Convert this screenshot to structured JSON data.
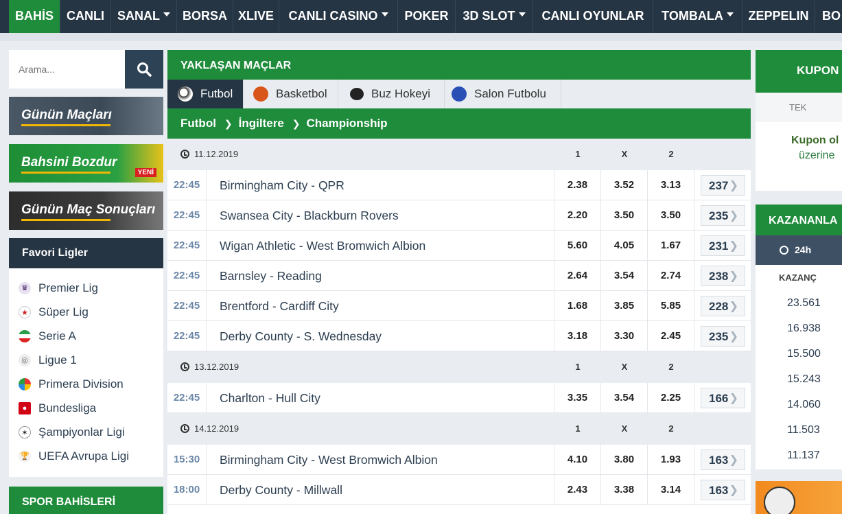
{
  "nav": {
    "items": [
      {
        "label": "BAHİS",
        "active": true,
        "dropdown": false
      },
      {
        "label": "CANLI",
        "active": false,
        "dropdown": false
      },
      {
        "label": "SANAL",
        "active": false,
        "dropdown": true
      },
      {
        "label": "BORSA",
        "active": false,
        "dropdown": false
      },
      {
        "label": "XLIVE",
        "active": false,
        "dropdown": false
      },
      {
        "label": "CANLI CASINO",
        "active": false,
        "dropdown": true
      },
      {
        "label": "POKER",
        "active": false,
        "dropdown": false
      },
      {
        "label": "3D SLOT",
        "active": false,
        "dropdown": true
      },
      {
        "label": "CANLI OYUNLAR",
        "active": false,
        "dropdown": false
      },
      {
        "label": "TOMBALA",
        "active": false,
        "dropdown": true
      },
      {
        "label": "ZEPPELIN",
        "active": false,
        "dropdown": false
      },
      {
        "label": "BO",
        "active": false,
        "dropdown": false
      }
    ]
  },
  "search": {
    "placeholder": "Arama..."
  },
  "banners": {
    "gunun_maclari": "Günün Maçları",
    "bahsini_bozdur": "Bahsini Bozdur",
    "yeni_badge": "YENİ",
    "mac_sonuclari": "Günün Maç Sonuçları"
  },
  "favorites": {
    "title": "Favori Ligler",
    "items": [
      "Premier Lig",
      "Süper Lig",
      "Serie A",
      "Ligue 1",
      "Primera Division",
      "Bundesliga",
      "Şampiyonlar Ligi",
      "UEFA Avrupa Ligi"
    ]
  },
  "spor_bahisleri": "SPOR BAHİSLERİ",
  "main": {
    "title": "YAKLAŞAN MAÇLAR",
    "tabs": [
      {
        "label": "Futbol",
        "active": true
      },
      {
        "label": "Basketbol",
        "active": false
      },
      {
        "label": "Buz Hokeyi",
        "active": false
      },
      {
        "label": "Salon Futbolu",
        "active": false
      }
    ],
    "breadcrumb": [
      "Futbol",
      "İngiltere",
      "Championship"
    ],
    "odds_headers": [
      "1",
      "X",
      "2"
    ],
    "groups": [
      {
        "date": "11.12.2019",
        "matches": [
          {
            "time": "22:45",
            "home": "Birmingham City",
            "away": "QPR",
            "o1": "2.38",
            "ox": "3.52",
            "o2": "3.13",
            "more": "237"
          },
          {
            "time": "22:45",
            "home": "Swansea City",
            "away": "Blackburn Rovers",
            "o1": "2.20",
            "ox": "3.50",
            "o2": "3.50",
            "more": "235"
          },
          {
            "time": "22:45",
            "home": "Wigan Athletic",
            "away": "West Bromwich Albion",
            "o1": "5.60",
            "ox": "4.05",
            "o2": "1.67",
            "more": "231"
          },
          {
            "time": "22:45",
            "home": "Barnsley",
            "away": "Reading",
            "o1": "2.64",
            "ox": "3.54",
            "o2": "2.74",
            "more": "238"
          },
          {
            "time": "22:45",
            "home": "Brentford",
            "away": "Cardiff City",
            "o1": "1.68",
            "ox": "3.85",
            "o2": "5.85",
            "more": "228"
          },
          {
            "time": "22:45",
            "home": "Derby County",
            "away": "S. Wednesday",
            "o1": "3.18",
            "ox": "3.30",
            "o2": "2.45",
            "more": "235"
          }
        ]
      },
      {
        "date": "13.12.2019",
        "matches": [
          {
            "time": "22:45",
            "home": "Charlton",
            "away": "Hull City",
            "o1": "3.35",
            "ox": "3.54",
            "o2": "2.25",
            "more": "166"
          }
        ]
      },
      {
        "date": "14.12.2019",
        "matches": [
          {
            "time": "15:30",
            "home": "Birmingham City",
            "away": "West Bromwich Albion",
            "o1": "4.10",
            "ox": "3.80",
            "o2": "1.93",
            "more": "163"
          },
          {
            "time": "18:00",
            "home": "Derby County",
            "away": "Millwall",
            "o1": "2.43",
            "ox": "3.38",
            "o2": "3.14",
            "more": "163"
          }
        ]
      }
    ]
  },
  "kupon": {
    "title": "KUPON",
    "tab": "TEK",
    "message_line1": "Kupon ol",
    "message_line2": "üzerine"
  },
  "kazananlar": {
    "title": "KAZANANLA",
    "tab": "24h",
    "column": "KAZANÇ",
    "values": [
      "23.561",
      "16.938",
      "15.500",
      "15.243",
      "14.060",
      "11.503",
      "11.137"
    ]
  },
  "colors": {
    "nav_bg": "#263544",
    "accent_green": "#1f8c3b",
    "time_blue": "#6b87a8"
  }
}
